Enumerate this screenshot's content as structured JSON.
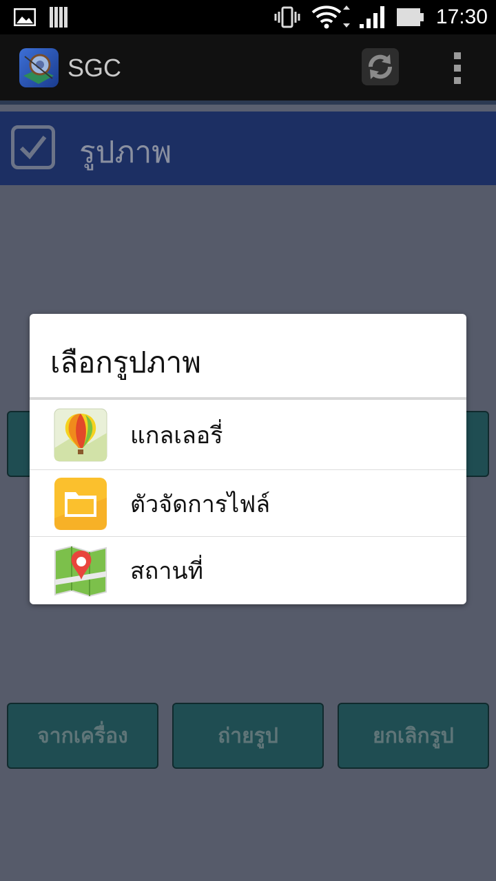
{
  "status_bar": {
    "time": "17:30"
  },
  "action_bar": {
    "app_title": "SGC"
  },
  "section": {
    "title": "รูปภาพ"
  },
  "dialog": {
    "title": "เลือกรูปภาพ",
    "options": [
      {
        "label": "แกลเลอรี่",
        "icon": "gallery-balloon-icon"
      },
      {
        "label": "ตัวจัดการไฟล์",
        "icon": "file-manager-folder-icon"
      },
      {
        "label": "สถานที่",
        "icon": "map-pin-icon"
      }
    ]
  },
  "buttons": {
    "from_device": "จากเครื่อง",
    "take_photo": "ถ่ายรูป",
    "cancel_photo": "ยกเลิกรูป"
  }
}
